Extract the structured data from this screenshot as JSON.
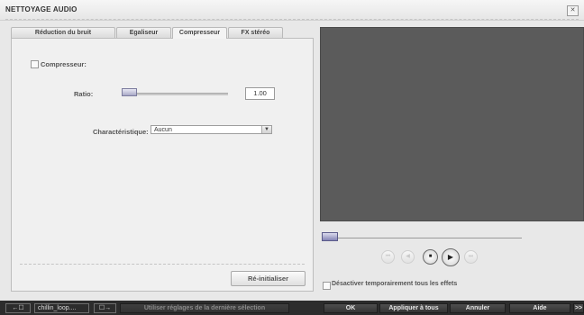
{
  "window": {
    "title": "NETTOYAGE AUDIO",
    "close_icon": "close-icon"
  },
  "tabs": [
    {
      "label": "Réduction du bruit",
      "active": false
    },
    {
      "label": "Egaliseur",
      "active": false
    },
    {
      "label": "Compresseur",
      "active": true
    },
    {
      "label": "FX stéréo",
      "active": false
    }
  ],
  "compressor": {
    "enable_label": "Compresseur:",
    "enabled": false,
    "ratio_label": "Ratio:",
    "ratio_value": "1.00",
    "ratio_slider_level": 0.0,
    "characteristic_label": "Charactéristique:",
    "characteristic_selected": "Aucun",
    "reset_label": "Ré-initialiser"
  },
  "preview": {
    "position_level": 0.0,
    "controls": [
      "skip-back-icon",
      "step-back-icon",
      "stop-icon",
      "play-icon",
      "skip-forward-icon"
    ],
    "disable_effects_label": "Désactiver temporairement tous les effets",
    "disable_effects_checked": false
  },
  "bottom_bar": {
    "clip_name": "chillin_loop....",
    "use_last_label": "Utiliser réglages de la dernière sélection",
    "ok_label": "OK",
    "apply_all_label": "Appliquer à tous",
    "cancel_label": "Annuler",
    "help_label": "Aide",
    "more_label": ">>"
  },
  "colors": {
    "preview_bg": "#5b5b5b",
    "bottom_bar_bg": "#2c2c2c",
    "slider_accent": "#8585b5"
  }
}
